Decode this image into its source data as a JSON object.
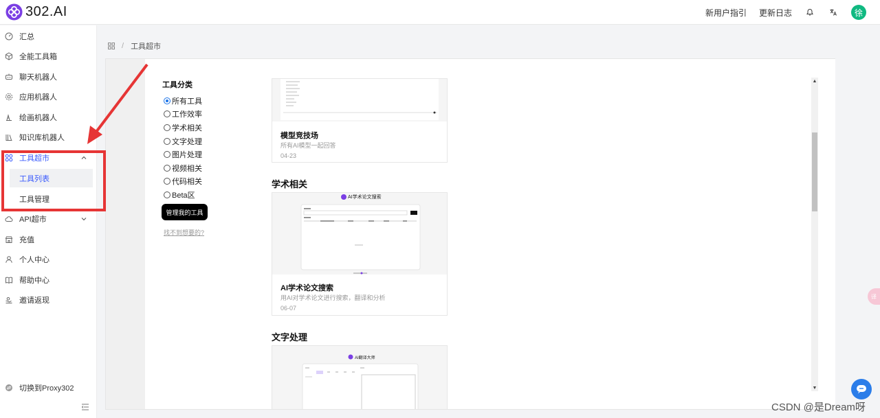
{
  "brand": {
    "name": "302.AI",
    "accent": "#3b5bfd",
    "logo_color": "#7b3fe4"
  },
  "header": {
    "links": [
      "新用户指引",
      "更新日志"
    ],
    "icons": [
      "bell-icon",
      "translate-icon"
    ],
    "avatar_text": "徐"
  },
  "sidebar": {
    "items": [
      {
        "label": "汇总",
        "icon": "dashboard-icon"
      },
      {
        "label": "全能工具箱",
        "icon": "cube-icon"
      },
      {
        "label": "聊天机器人",
        "icon": "robot-icon"
      },
      {
        "label": "应用机器人",
        "icon": "gear-icon"
      },
      {
        "label": "绘画机器人",
        "icon": "paint-icon"
      },
      {
        "label": "知识库机器人",
        "icon": "books-icon"
      },
      {
        "label": "工具超市",
        "icon": "apps-icon",
        "active": true,
        "expanded": true
      },
      {
        "label": "API超市",
        "icon": "cloud-icon"
      },
      {
        "label": "充值",
        "icon": "store-icon"
      },
      {
        "label": "个人中心",
        "icon": "user-icon"
      },
      {
        "label": "帮助中心",
        "icon": "book-icon"
      },
      {
        "label": "邀请返现",
        "icon": "gift-icon"
      }
    ],
    "sub_items": [
      {
        "label": "工具列表",
        "active": true
      },
      {
        "label": "工具管理"
      }
    ],
    "proxy_label": "切换到Proxy302"
  },
  "breadcrumb": {
    "current": "工具超市"
  },
  "filters": {
    "title": "工具分类",
    "options": [
      "所有工具",
      "工作效率",
      "学术相关",
      "文字处理",
      "图片处理",
      "视频相关",
      "代码相关",
      "Beta区"
    ],
    "selected": "所有工具",
    "manage_button": "管理我的工具",
    "not_found": "找不到想要的?"
  },
  "cards": [
    {
      "title": "模型竞技场",
      "desc": "所有AI模型一起回答",
      "date": "04-23"
    },
    {
      "title": "AI学术论文搜索",
      "desc": "用AI对学术论文进行搜索，翻译和分析",
      "date": "06-07",
      "thumb_label": "AI学术论文搜索"
    }
  ],
  "sections": [
    "学术相关",
    "文字处理"
  ],
  "translate_thumb_label": "AI翻译大师",
  "watermark": "CSDN @是Dream呀",
  "pink_tab": "译"
}
